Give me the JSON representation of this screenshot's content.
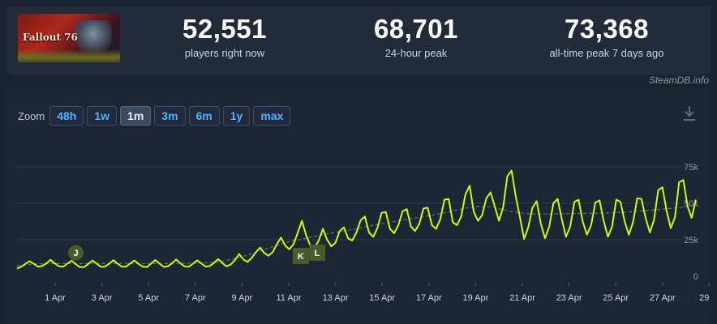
{
  "game": {
    "logo_text": "Fallout 76"
  },
  "stats": [
    {
      "value": "52,551",
      "label": "players right now"
    },
    {
      "value": "68,701",
      "label": "24-hour peak"
    },
    {
      "value": "73,368",
      "label": "all-time peak 7 days ago"
    }
  ],
  "brand": "SteamDB.info",
  "zoom": {
    "label": "Zoom",
    "options": [
      "48h",
      "1w",
      "1m",
      "3m",
      "6m",
      "1y",
      "max"
    ],
    "active": "1m"
  },
  "colors": {
    "line": "#c8ff00",
    "avg_line": "#5e6b7c",
    "grid": "#2d3748",
    "marker_bg": "#4a5a2a"
  },
  "icons": {
    "download": "download-icon"
  },
  "chart_data": {
    "type": "line",
    "x_ticks": [
      "1 Apr",
      "3 Apr",
      "5 Apr",
      "7 Apr",
      "9 Apr",
      "11 Apr",
      "13 Apr",
      "15 Apr",
      "17 Apr",
      "19 Apr",
      "21 Apr",
      "23 Apr",
      "25 Apr",
      "27 Apr",
      "29 ..."
    ],
    "y_ticks": [
      "0",
      "25k",
      "50k",
      "75k"
    ],
    "ylim": [
      0,
      80000
    ],
    "grid": true,
    "annotations": [
      {
        "label": "J",
        "day": 1.4
      },
      {
        "label": "K",
        "day": 11.1
      },
      {
        "label": "L",
        "day": 11.8
      }
    ],
    "series": [
      {
        "values": [
          5200,
          6500,
          8500,
          10200,
          8500,
          6500,
          7000,
          8800,
          11200,
          8800,
          6800,
          6500,
          8600,
          10700,
          8300,
          6200,
          6300,
          8400,
          10800,
          8600,
          6400,
          6600,
          8600,
          11000,
          8600,
          6500,
          6500,
          8700,
          10800,
          8500,
          6500,
          6300,
          8600,
          11100,
          8600,
          6400,
          6800,
          8900,
          11500,
          8800,
          6700,
          6500,
          8600,
          10900,
          8700,
          6600,
          7000,
          9100,
          11800,
          9000,
          6800,
          8000,
          11000,
          15200,
          11500,
          9800,
          12500,
          16500,
          19600,
          16000,
          14000,
          16500,
          22000,
          26500,
          21000,
          18500,
          22000,
          30000,
          38000,
          28000,
          21000,
          19500,
          24500,
          32500,
          25000,
          20500,
          23000,
          31000,
          33500,
          26000,
          24500,
          30000,
          38500,
          41000,
          30000,
          27000,
          33000,
          43500,
          44000,
          32500,
          29500,
          35000,
          44500,
          46000,
          34000,
          31000,
          36000,
          46500,
          47000,
          35000,
          32500,
          39000,
          52500,
          53000,
          37000,
          35000,
          41000,
          56000,
          62000,
          44000,
          38000,
          42000,
          53500,
          57500,
          48000,
          38000,
          47000,
          68500,
          72500,
          55000,
          40500,
          25500,
          33500,
          47000,
          51500,
          36000,
          26000,
          34000,
          50000,
          53000,
          39000,
          27000,
          34000,
          51000,
          52500,
          37500,
          28500,
          35000,
          50500,
          52000,
          38000,
          27000,
          34000,
          52500,
          51000,
          37500,
          28500,
          37000,
          53500,
          53000,
          40000,
          30000,
          38500,
          59000,
          61000,
          45000,
          33000,
          40500,
          64500,
          66000,
          48000,
          40000,
          52500
        ]
      },
      {
        "name": "",
        "values": [
          7000,
          8400,
          8600,
          8700,
          8600,
          8700,
          8800,
          8700,
          8600,
          8700,
          8800,
          9000,
          10000,
          12500,
          16000,
          20000,
          23500,
          26000,
          28500,
          30500,
          32500,
          35000,
          37000,
          39000,
          41000,
          43000,
          45500,
          48000,
          47500,
          44500,
          43000,
          42500,
          42800,
          43000,
          43200,
          43500,
          44000,
          45000,
          46000,
          47000,
          49000
        ]
      }
    ]
  }
}
